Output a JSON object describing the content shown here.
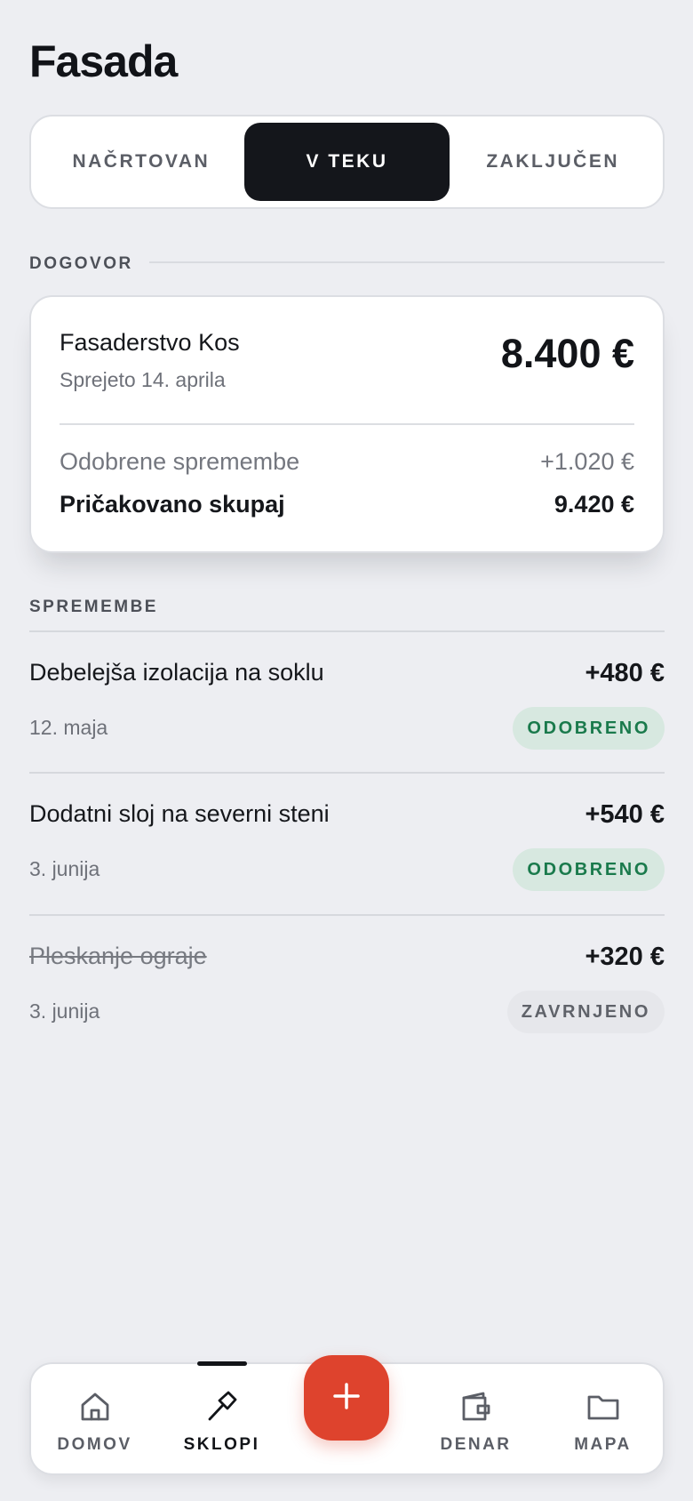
{
  "page": {
    "title": "Fasada"
  },
  "status_tabs": [
    {
      "label": "NAČRTOVAN",
      "active": false
    },
    {
      "label": "V TEKU",
      "active": true
    },
    {
      "label": "ZAKLJUČEN",
      "active": false
    }
  ],
  "contract": {
    "section_label": "DOGOVOR",
    "vendor": "Fasaderstvo Kos",
    "accepted": "Sprejeto 14. aprila",
    "amount": "8.400 €",
    "approved_changes_label": "Odobrene spremembe",
    "approved_changes_value": "+1.020 €",
    "expected_total_label": "Pričakovano skupaj",
    "expected_total_value": "9.420 €"
  },
  "changes": {
    "section_label": "SPREMEMBE",
    "items": [
      {
        "name": "Debelejša izolacija na soklu",
        "amount": "+480 €",
        "date": "12. maja",
        "status": "ODOBRENO",
        "status_type": "approved",
        "struck": false
      },
      {
        "name": "Dodatni sloj na severni steni",
        "amount": "+540 €",
        "date": "3. junija",
        "status": "ODOBRENO",
        "status_type": "approved",
        "struck": false
      },
      {
        "name": "Pleskanje ograje",
        "amount": "+320 €",
        "date": "3. junija",
        "status": "ZAVRNJENO",
        "status_type": "rejected",
        "struck": true
      }
    ]
  },
  "bottom_nav": {
    "items": [
      {
        "label": "DOMOV",
        "icon": "home-icon",
        "active": false
      },
      {
        "label": "SKLOPI",
        "icon": "hammer-icon",
        "active": true
      },
      {
        "label": "DENAR",
        "icon": "wallet-icon",
        "active": false
      },
      {
        "label": "MAPA",
        "icon": "folder-icon",
        "active": false
      }
    ],
    "fab_icon": "plus-icon"
  },
  "colors": {
    "background": "#edeef2",
    "accent": "#de432d",
    "active_tab": "#14161b",
    "approved_bg": "#d7e8e0",
    "approved_text": "#1a7a4c",
    "rejected_bg": "#e6e7eb"
  }
}
